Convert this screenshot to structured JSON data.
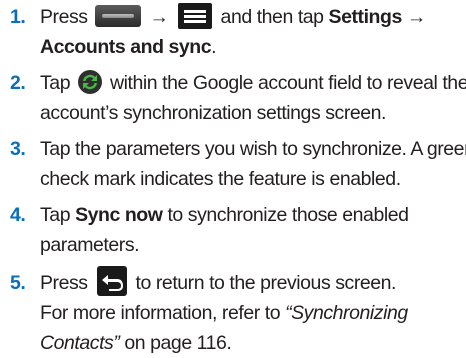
{
  "steps": [
    {
      "num": "1.",
      "lines": {
        "press": "Press",
        "arrow1": "→",
        "and_then": "and then tap",
        "settings": "Settings →",
        "accounts": "Accounts and sync",
        "period": "."
      }
    },
    {
      "num": "2.",
      "lines": {
        "tap": "Tap",
        "rest1": "within the Google account field to reveal the",
        "rest2": "account’s synchronization settings screen."
      }
    },
    {
      "num": "3.",
      "lines": {
        "l1": "Tap the parameters you wish to synchronize. A green",
        "l2": "check mark indicates the feature is enabled."
      }
    },
    {
      "num": "4.",
      "lines": {
        "tap": "Tap",
        "sync_now": "Sync now",
        "rest1": "to synchronize those enabled",
        "l2": "parameters."
      }
    },
    {
      "num": "5.",
      "lines": {
        "press": "Press",
        "rest1": "to return to the previous screen.",
        "for_more": "For more information, refer to",
        "ref_title1": "“Synchronizing",
        "ref_title2": "Contacts”",
        "on_page": "on page 116."
      }
    }
  ],
  "icons": {
    "home": "home-key-icon",
    "menu": "menu-key-icon",
    "sync": "sync-icon",
    "back": "back-key-icon"
  },
  "colors": {
    "step_number": "#0a6fb8",
    "sync_green": "#3aa63a",
    "text": "#231f20"
  }
}
